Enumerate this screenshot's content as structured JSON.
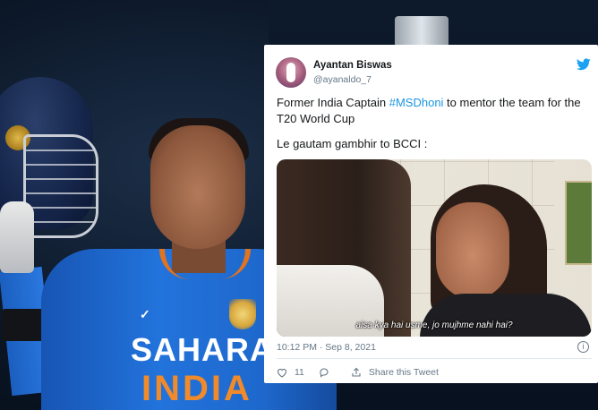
{
  "background_photo": {
    "jersey_sponsor_top": "SAHARA",
    "jersey_sponsor_bottom": "INDIA"
  },
  "tweet": {
    "author_name": "Ayantan Biswas",
    "author_handle": "@ayanaldo_7",
    "text_before_hashtag": "Former India Captain ",
    "hashtag": "#MSDhoni",
    "text_after_hashtag": " to mentor the team for the T20 World Cup",
    "text_line2": "Le gautam gambhir to BCCI :",
    "media_subtitle": "aisa kya hai usme, jo mujhme nahi hai?",
    "timestamp": "10:12 PM · Sep 8, 2021",
    "like_count": "11",
    "share_label": "Share this Tweet",
    "icons": [
      "twitter-bird-icon",
      "info-icon",
      "heart-icon",
      "reply-icon",
      "share-icon"
    ],
    "accent_color": "#1DA1F2"
  }
}
